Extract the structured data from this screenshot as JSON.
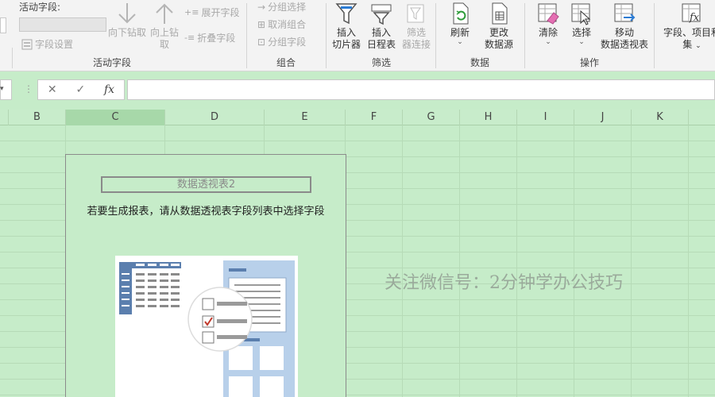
{
  "ribbon": {
    "active_field": {
      "label": "活动字段:",
      "field_settings": "字段设置",
      "drill_down": "向下钻取",
      "drill_up": "向上钻取",
      "expand_field": "展开字段",
      "collapse_field": "折叠字段",
      "group_label": "活动字段"
    },
    "group": {
      "group_selection": "分组选择",
      "ungroup": "取消组合",
      "group_field": "分组字段",
      "group_label": "组合"
    },
    "filter": {
      "insert_slicer": "插入\n切片器",
      "insert_slicer_l1": "插入",
      "insert_slicer_l2": "切片器",
      "insert_timeline_l1": "插入",
      "insert_timeline_l2": "日程表",
      "filter_conn_l1": "筛选",
      "filter_conn_l2": "器连接",
      "group_label": "筛选"
    },
    "data": {
      "refresh": "刷新",
      "change_source_l1": "更改",
      "change_source_l2": "数据源",
      "group_label": "数据"
    },
    "actions": {
      "clear": "清除",
      "select": "选择",
      "move_l1": "移动",
      "move_l2": "数据透视表",
      "group_label": "操作"
    },
    "calc": {
      "fields_items_l1": "字段、项目和",
      "fields_items_l2": "集"
    }
  },
  "formula_bar": {
    "cancel": "✕",
    "enter": "✓",
    "fx": "fx",
    "value": ""
  },
  "columns": [
    "B",
    "C",
    "D",
    "E",
    "F",
    "G",
    "H",
    "I",
    "J",
    "K"
  ],
  "selected_column": "C",
  "pivot": {
    "title": "数据透视表2",
    "message": "若要生成报表，请从数据透视表字段列表中选择字段"
  },
  "watermark": "关注微信号：2分钟学办公技巧"
}
